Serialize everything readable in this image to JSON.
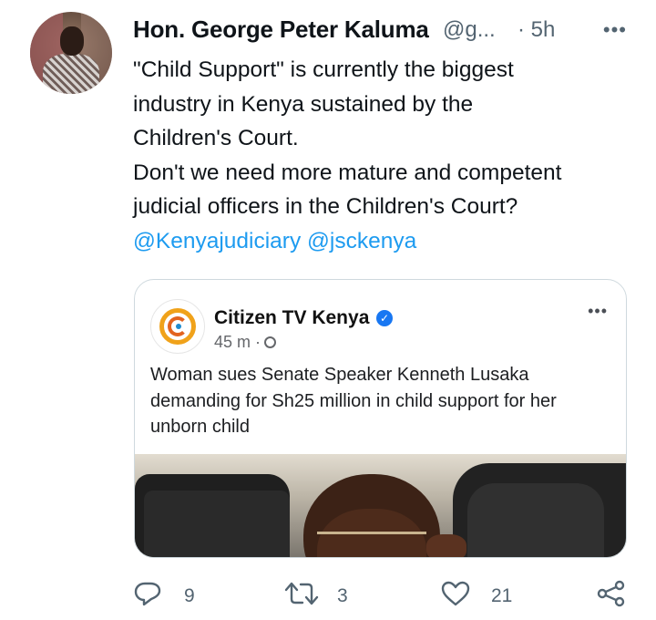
{
  "tweet": {
    "author": {
      "name": "Hon. George Peter Kaluma",
      "handle": "@g...",
      "time_separator": "·",
      "time": "5h"
    },
    "more_label": "•••",
    "text_lines": [
      "\"Child Support\" is currently the biggest",
      "industry in Kenya sustained by the",
      "Children's Court.",
      "Don't we need more mature and competent",
      "judicial officers in the Children's Court?"
    ],
    "mentions": [
      "@Kenyajudiciary",
      "@jsckenya"
    ]
  },
  "card": {
    "page_name": "Citizen TV Kenya",
    "verified_mark": "✓",
    "time": "45 m ·",
    "more_label": "•••",
    "text_lines": [
      "Woman sues Senate Speaker Kenneth Lusaka",
      "demanding for Sh25 million in child support for her",
      "unborn child"
    ]
  },
  "actions": {
    "reply_count": "9",
    "retweet_count": "3",
    "like_count": "21"
  },
  "icons": {
    "reply": "reply-icon",
    "retweet": "retweet-icon",
    "like": "like-icon",
    "share": "share-icon",
    "globe": "globe-icon"
  },
  "colors": {
    "accent": "#1d9bf0",
    "secondary_text": "#536471",
    "card_border": "#cfd9de",
    "verified": "#1877f2"
  }
}
